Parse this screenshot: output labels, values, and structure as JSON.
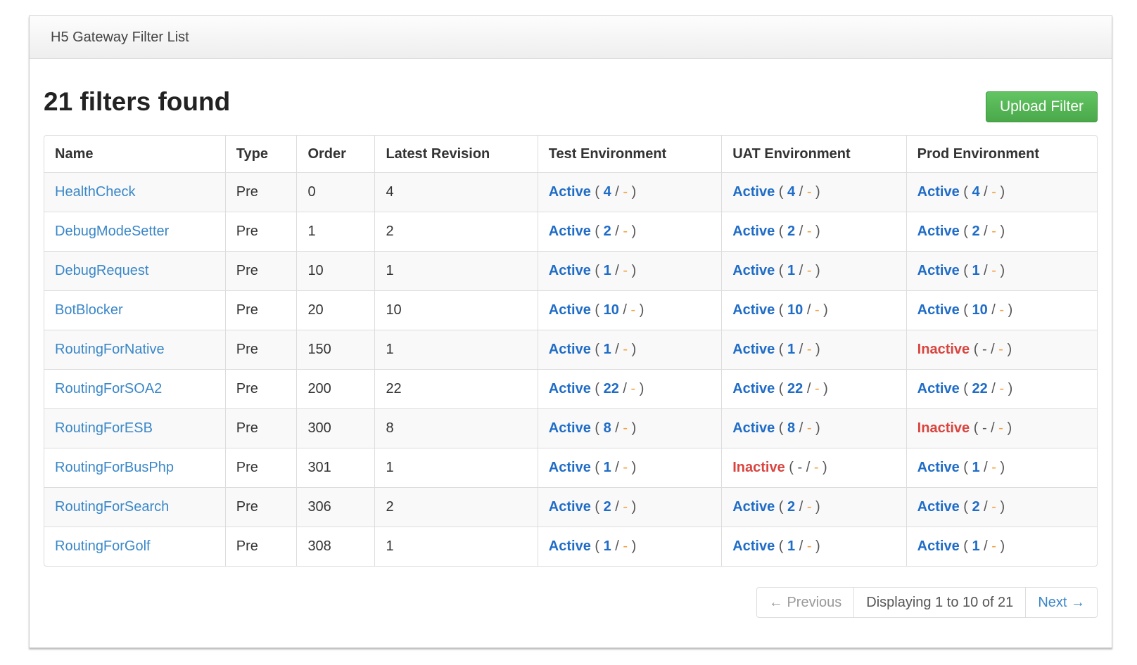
{
  "window": {
    "title": "H5 Gateway Filter List"
  },
  "header": {
    "title": "21 filters found",
    "upload_label": "Upload Filter"
  },
  "table": {
    "columns": [
      "Name",
      "Type",
      "Order",
      "Latest Revision",
      "Test Environment",
      "UAT Environment",
      "Prod Environment"
    ],
    "rows": [
      {
        "name": "HealthCheck",
        "type": "Pre",
        "order": "0",
        "revision": "4",
        "envs": [
          {
            "status": "Active",
            "rev": "4"
          },
          {
            "status": "Active",
            "rev": "4"
          },
          {
            "status": "Active",
            "rev": "4"
          }
        ]
      },
      {
        "name": "DebugModeSetter",
        "type": "Pre",
        "order": "1",
        "revision": "2",
        "envs": [
          {
            "status": "Active",
            "rev": "2"
          },
          {
            "status": "Active",
            "rev": "2"
          },
          {
            "status": "Active",
            "rev": "2"
          }
        ]
      },
      {
        "name": "DebugRequest",
        "type": "Pre",
        "order": "10",
        "revision": "1",
        "envs": [
          {
            "status": "Active",
            "rev": "1"
          },
          {
            "status": "Active",
            "rev": "1"
          },
          {
            "status": "Active",
            "rev": "1"
          }
        ]
      },
      {
        "name": "BotBlocker",
        "type": "Pre",
        "order": "20",
        "revision": "10",
        "envs": [
          {
            "status": "Active",
            "rev": "10"
          },
          {
            "status": "Active",
            "rev": "10"
          },
          {
            "status": "Active",
            "rev": "10"
          }
        ]
      },
      {
        "name": "RoutingForNative",
        "type": "Pre",
        "order": "150",
        "revision": "1",
        "envs": [
          {
            "status": "Active",
            "rev": "1"
          },
          {
            "status": "Active",
            "rev": "1"
          },
          {
            "status": "Inactive",
            "rev": "-"
          }
        ]
      },
      {
        "name": "RoutingForSOA2",
        "type": "Pre",
        "order": "200",
        "revision": "22",
        "envs": [
          {
            "status": "Active",
            "rev": "22"
          },
          {
            "status": "Active",
            "rev": "22"
          },
          {
            "status": "Active",
            "rev": "22"
          }
        ]
      },
      {
        "name": "RoutingForESB",
        "type": "Pre",
        "order": "300",
        "revision": "8",
        "envs": [
          {
            "status": "Active",
            "rev": "8"
          },
          {
            "status": "Active",
            "rev": "8"
          },
          {
            "status": "Inactive",
            "rev": "-"
          }
        ]
      },
      {
        "name": "RoutingForBusPhp",
        "type": "Pre",
        "order": "301",
        "revision": "1",
        "envs": [
          {
            "status": "Active",
            "rev": "1"
          },
          {
            "status": "Inactive",
            "rev": "-"
          },
          {
            "status": "Active",
            "rev": "1"
          }
        ]
      },
      {
        "name": "RoutingForSearch",
        "type": "Pre",
        "order": "306",
        "revision": "2",
        "envs": [
          {
            "status": "Active",
            "rev": "2"
          },
          {
            "status": "Active",
            "rev": "2"
          },
          {
            "status": "Active",
            "rev": "2"
          }
        ]
      },
      {
        "name": "RoutingForGolf",
        "type": "Pre",
        "order": "308",
        "revision": "1",
        "envs": [
          {
            "status": "Active",
            "rev": "1"
          },
          {
            "status": "Active",
            "rev": "1"
          },
          {
            "status": "Active",
            "rev": "1"
          }
        ]
      }
    ]
  },
  "env_status_format": {
    "open": " ( ",
    "sep": " / ",
    "pending": "-",
    "close": " )"
  },
  "pagination": {
    "prev_label": "← Previous",
    "info": "Displaying 1 to 10 of 21",
    "next_label": "Next →"
  },
  "colors": {
    "link": "#3a87c8",
    "active": "#1f6cc7",
    "inactive": "#d9443f",
    "pending": "#f0a040",
    "upload_button": "#5cb85c"
  }
}
